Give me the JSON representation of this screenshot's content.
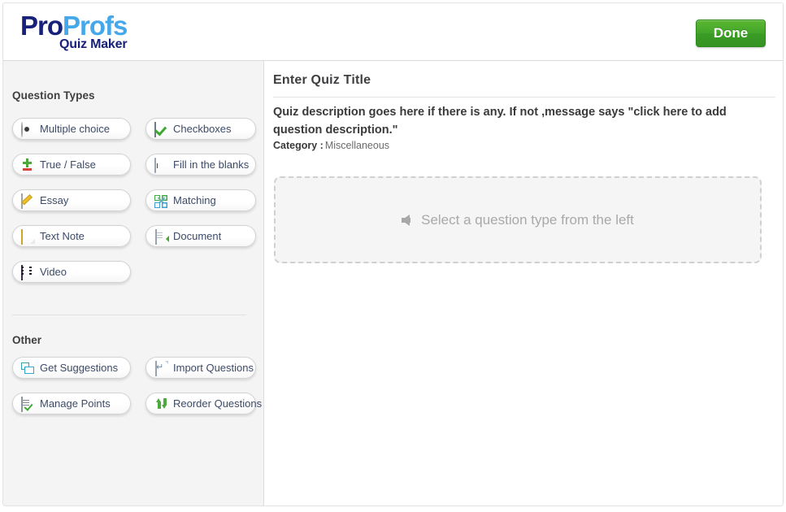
{
  "header": {
    "logo_pro": "Pro",
    "logo_profs": "Profs",
    "logo_sub": "Quiz Maker",
    "done_label": "Done",
    "done_color": "#41a52a"
  },
  "sidebar": {
    "title": "Question Types",
    "other_title": "Other",
    "question_types": [
      {
        "label": "Multiple choice",
        "icon": "radio-button-icon"
      },
      {
        "label": "Checkboxes",
        "icon": "checkbox-icon"
      },
      {
        "label": "True / False",
        "icon": "plus-minus-icon"
      },
      {
        "label": "Fill in the blanks",
        "icon": "text-field-icon"
      },
      {
        "label": "Essay",
        "icon": "pencil-note-icon"
      },
      {
        "label": "Matching",
        "icon": "node-graph-icon"
      },
      {
        "label": "Text Note",
        "icon": "sticky-note-icon"
      },
      {
        "label": "Document",
        "icon": "document-upload-icon"
      },
      {
        "label": "Video",
        "icon": "film-strip-icon"
      }
    ],
    "other_items": [
      {
        "label": "Get Suggestions",
        "icon": "speech-bubbles-icon"
      },
      {
        "label": "Import Questions",
        "icon": "import-page-icon"
      },
      {
        "label": "Manage Points",
        "icon": "list-check-icon"
      },
      {
        "label": "Reorder Questions",
        "icon": "up-down-arrows-icon"
      }
    ]
  },
  "main": {
    "quiz_title": "Enter Quiz Title",
    "quiz_description": "Quiz description goes here if there is any. If not ,message says \"click here to add question description.\"",
    "category_label": "Category :",
    "category_value": "Miscellaneous",
    "dropzone_text": "Select a question type from the left",
    "dropzone_arrow_icon": "arrow-left-icon"
  }
}
